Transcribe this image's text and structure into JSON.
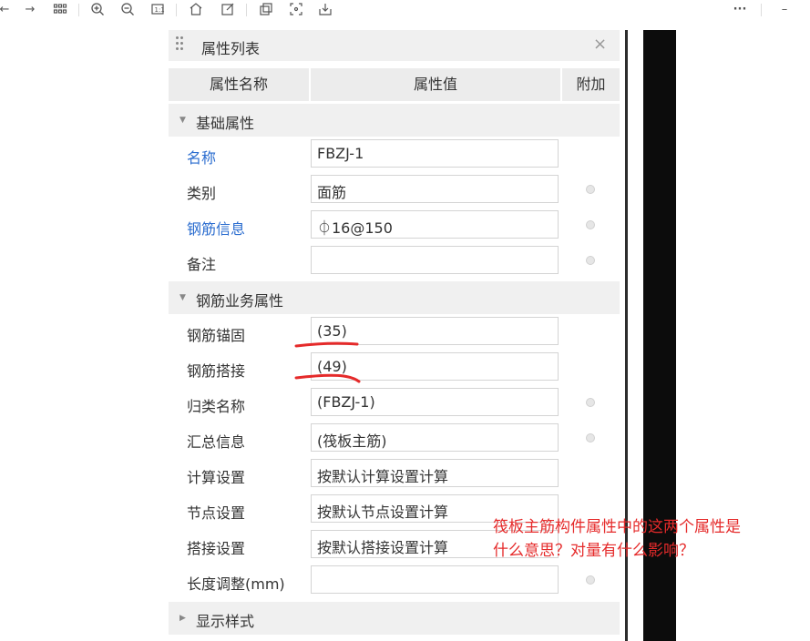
{
  "toolbar": {
    "icons": [
      "back-arrow",
      "forward-arrow",
      "grid",
      "zoom-in",
      "zoom-out",
      "fit-screen",
      "home",
      "edit",
      "copy",
      "crop",
      "download"
    ],
    "more": "···",
    "minimize": "–"
  },
  "panel": {
    "title": "属性列表",
    "close": "×",
    "columns": [
      "属性名称",
      "属性值",
      "附加"
    ],
    "sections": {
      "basic": "基础属性",
      "rebar_business": "钢筋业务属性",
      "display_style": "显示样式"
    },
    "rows": [
      {
        "name": "名称",
        "value": "FBZJ-1"
      },
      {
        "name": "类别",
        "value": "面筋"
      },
      {
        "name": "钢筋信息",
        "value": "⏀16@150"
      },
      {
        "name": "备注",
        "value": ""
      },
      {
        "name": "钢筋锚固",
        "value": "(35)"
      },
      {
        "name": "钢筋搭接",
        "value": "(49)"
      },
      {
        "name": "归类名称",
        "value": "(FBZJ-1)"
      },
      {
        "name": "汇总信息",
        "value": "(筏板主筋)"
      },
      {
        "name": "计算设置",
        "value": "按默认计算设置计算"
      },
      {
        "name": "节点设置",
        "value": "按默认节点设置计算"
      },
      {
        "name": "搭接设置",
        "value": "按默认搭接设置计算"
      },
      {
        "name": "长度调整(mm)",
        "value": ""
      }
    ]
  },
  "annotation": {
    "line1": "筏板主筋构件属性中的这两个属性是",
    "line2": "什么意思？对量有什么影响？"
  },
  "colors": {
    "link": "#2a6ccf",
    "annotation": "#e52a2a",
    "header_bg": "#ececec"
  }
}
